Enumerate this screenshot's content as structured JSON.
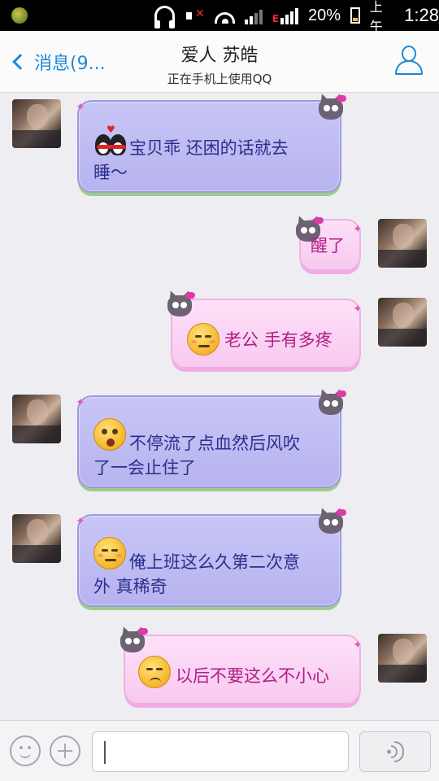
{
  "status_bar": {
    "battery": "20%",
    "ampm": "上午",
    "time": "1:28",
    "network_type": "E"
  },
  "header": {
    "back_label": "消息(9...",
    "contact_name": "爱人  苏皓",
    "contact_status": "正在手机上使用QQ"
  },
  "messages": [
    {
      "direction": "in",
      "emoticon": "penguin-couple-icon",
      "text_line1": "宝贝乖  还困的话就去",
      "text_line2": "睡～"
    },
    {
      "direction": "out",
      "text_line1": "醒了"
    },
    {
      "direction": "out",
      "emoticon": "smirk-face-icon",
      "text_line1": "老公  手有多疼"
    },
    {
      "direction": "in",
      "emoticon": "shocked-face-icon",
      "text_line1": "不停流了点血然后风吹",
      "text_line2": "了一会止住了"
    },
    {
      "direction": "in",
      "emoticon": "smirk-face-icon",
      "text_line1": "俺上班这么久第二次意",
      "text_line2": "外 真稀奇"
    },
    {
      "direction": "out",
      "emoticon": "frown-face-icon",
      "text_line1": "以后不要这么不小心"
    }
  ],
  "input_bar": {
    "value": "",
    "placeholder": ""
  },
  "colors": {
    "accent": "#1e88d6",
    "incoming_bubble": "#bdbbf2",
    "incoming_text": "#2a2f8c",
    "outgoing_bubble": "#fbd3f4",
    "outgoing_text": "#b01e86"
  }
}
